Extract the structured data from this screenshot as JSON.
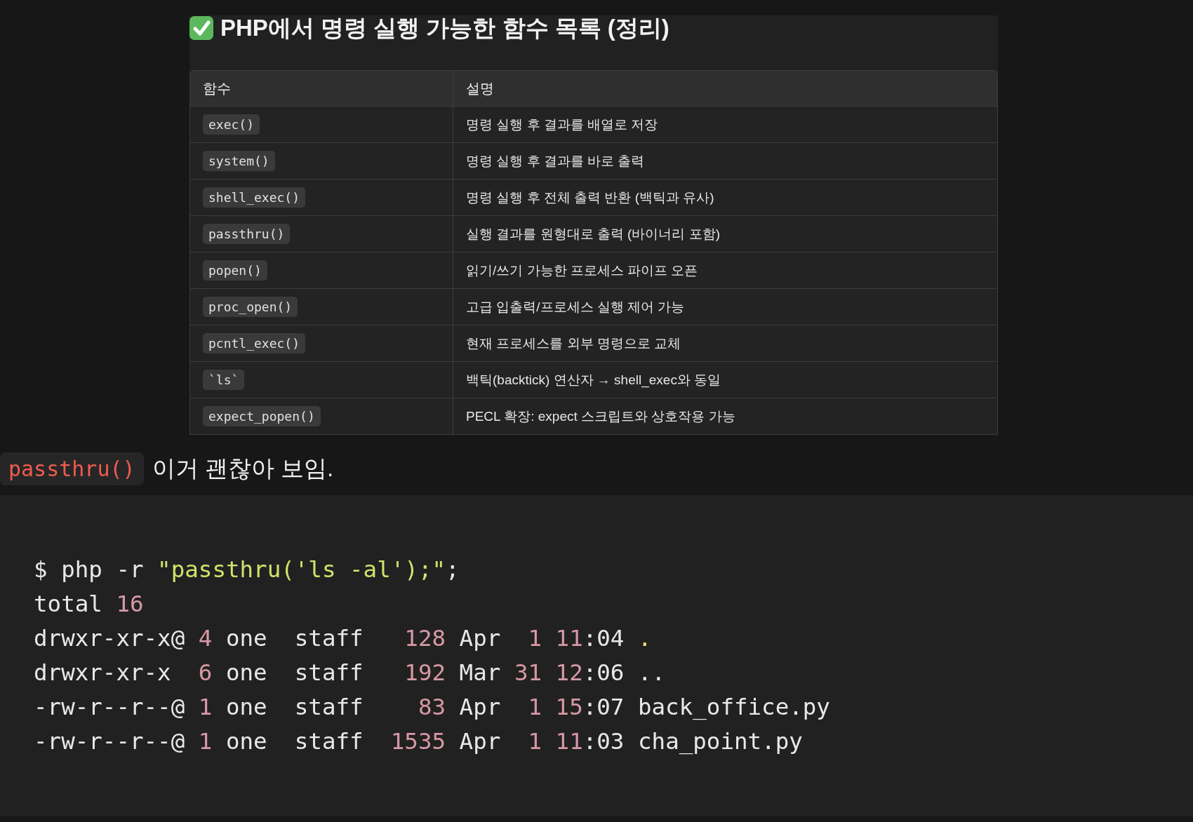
{
  "summary": {
    "title": "PHP에서 명령 실행 가능한 함수 목록 (정리)",
    "table": {
      "columns": [
        "함수",
        "설명"
      ],
      "rows": [
        {
          "function": "exec()",
          "description": "명령 실행 후 결과를 배열로 저장"
        },
        {
          "function": "system()",
          "description": "명령 실행 후 결과를 바로 출력"
        },
        {
          "function": "shell_exec()",
          "description": "명령 실행 후 전체 출력 반환 (백틱과 유사)"
        },
        {
          "function": "passthru()",
          "description": "실행 결과를 원형대로 출력 (바이너리 포함)"
        },
        {
          "function": "popen()",
          "description": "읽기/쓰기 가능한 프로세스 파이프 오픈"
        },
        {
          "function": "proc_open()",
          "description": "고급 입출력/프로세스 실행 제어 가능"
        },
        {
          "function": "pcntl_exec()",
          "description": "현재 프로세스를 외부 명령으로 교체"
        },
        {
          "function": "`ls`",
          "description": "백틱(backtick) 연산자 → shell_exec와 동일"
        },
        {
          "function": "expect_popen()",
          "description": "PECL 확장: expect 스크립트와 상호작용 가능"
        }
      ]
    }
  },
  "message": {
    "code": "passthru()",
    "text": "이거 괜찮아 보임."
  },
  "terminal": {
    "lines": [
      [
        {
          "kind": "plain",
          "text": "$ php -r "
        },
        {
          "kind": "string",
          "text": "\"passthru('ls -al');\""
        },
        {
          "kind": "plain",
          "text": ";"
        }
      ],
      [
        {
          "kind": "plain",
          "text": "total "
        },
        {
          "kind": "number",
          "text": "16"
        }
      ],
      [
        {
          "kind": "plain",
          "text": "drwxr-xr-x@ "
        },
        {
          "kind": "number",
          "text": "4"
        },
        {
          "kind": "plain",
          "text": " one  staff   "
        },
        {
          "kind": "number",
          "text": "128"
        },
        {
          "kind": "plain",
          "text": " Apr  "
        },
        {
          "kind": "number",
          "text": "1"
        },
        {
          "kind": "number",
          "text": " 11"
        },
        {
          "kind": "plain",
          "text": ":04 "
        },
        {
          "kind": "dot",
          "text": "."
        }
      ],
      [
        {
          "kind": "plain",
          "text": "drwxr-xr-x  "
        },
        {
          "kind": "number",
          "text": "6"
        },
        {
          "kind": "plain",
          "text": " one  staff   "
        },
        {
          "kind": "number",
          "text": "192"
        },
        {
          "kind": "plain",
          "text": " Mar "
        },
        {
          "kind": "number",
          "text": "31"
        },
        {
          "kind": "number",
          "text": " 12"
        },
        {
          "kind": "plain",
          "text": ":06 .."
        }
      ],
      [
        {
          "kind": "plain",
          "text": "-rw-r--r--@ "
        },
        {
          "kind": "number",
          "text": "1"
        },
        {
          "kind": "plain",
          "text": " one  staff    "
        },
        {
          "kind": "number",
          "text": "83"
        },
        {
          "kind": "plain",
          "text": " Apr  "
        },
        {
          "kind": "number",
          "text": "1"
        },
        {
          "kind": "number",
          "text": " 15"
        },
        {
          "kind": "plain",
          "text": ":07 back_office.py"
        }
      ],
      [
        {
          "kind": "plain",
          "text": "-rw-r--r--@ "
        },
        {
          "kind": "number",
          "text": "1"
        },
        {
          "kind": "plain",
          "text": " one  staff  "
        },
        {
          "kind": "number",
          "text": "1535"
        },
        {
          "kind": "plain",
          "text": " Apr  "
        },
        {
          "kind": "number",
          "text": "1"
        },
        {
          "kind": "number",
          "text": " 11"
        },
        {
          "kind": "plain",
          "text": ":03 cha_point.py"
        }
      ]
    ]
  }
}
